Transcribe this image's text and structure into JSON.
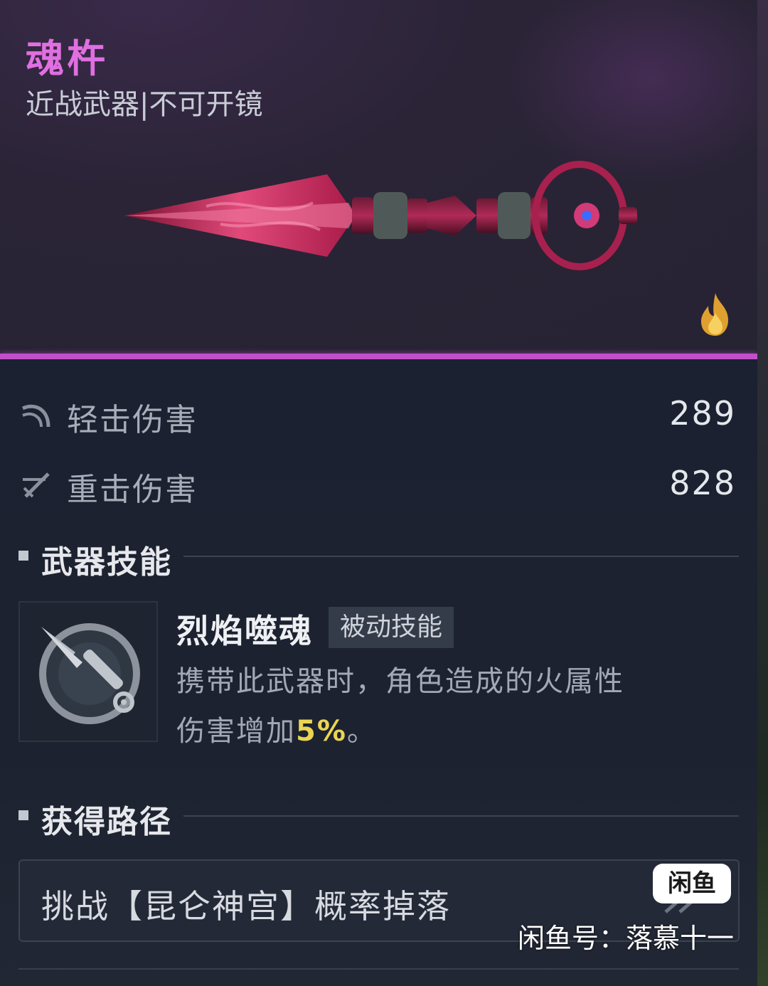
{
  "item": {
    "name": "魂杵",
    "subtitle": "近战武器|不可开镜"
  },
  "icons": {
    "weapon": "vajra-dagger-image",
    "element": "fire-icon",
    "light_attack": "light-attack-icon",
    "heavy_attack": "heavy-attack-icon",
    "skill": "skill-dagger-icon"
  },
  "colors": {
    "accent": "#c14fca",
    "title": "#e06fe0",
    "highlight": "#ead452"
  },
  "stats": [
    {
      "label": "轻击伤害",
      "value": "289"
    },
    {
      "label": "重击伤害",
      "value": "828"
    }
  ],
  "skill_section": {
    "title": "武器技能",
    "skill_name": "烈焰噬魂",
    "badge": "被动技能",
    "desc_line1": "携带此武器时，角色造成的火属性",
    "desc_line2_prefix": "伤害增加",
    "desc_highlight": "5%",
    "desc_suffix": "。"
  },
  "source_section": {
    "title": "获得路径",
    "text": "挑战【昆仑神宫】概率掉落"
  },
  "watermark": {
    "logo": "闲鱼",
    "text": "闲鱼号：落慕十一"
  }
}
